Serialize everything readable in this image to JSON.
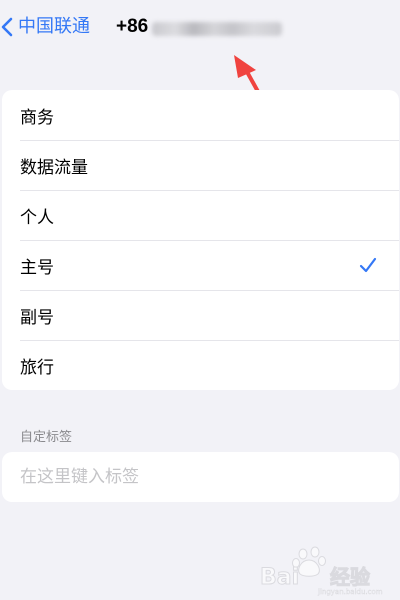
{
  "navbar": {
    "back_label": "中国联通",
    "title_prefix": "+86"
  },
  "labels": [
    {
      "label": "商务",
      "selected": false
    },
    {
      "label": "数据流量",
      "selected": false
    },
    {
      "label": "个人",
      "selected": false
    },
    {
      "label": "主号",
      "selected": true
    },
    {
      "label": "副号",
      "selected": false
    },
    {
      "label": "旅行",
      "selected": false
    }
  ],
  "custom_label": {
    "header": "自定标签",
    "placeholder": "在这里键入标签",
    "value": ""
  },
  "colors": {
    "accent": "#3478f6",
    "arrow": "#f0433f",
    "background": "#f2f2f7"
  },
  "icons": {
    "back": "chevron-left-icon",
    "selected": "checkmark-icon"
  }
}
